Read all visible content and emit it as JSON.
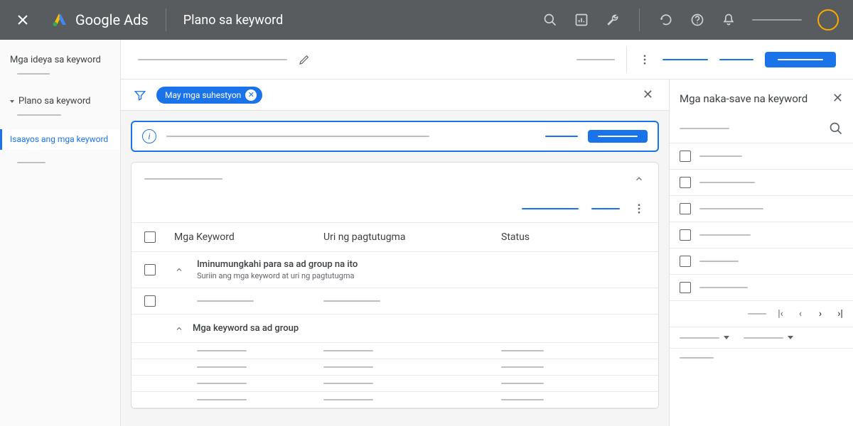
{
  "header": {
    "product": "Google Ads",
    "title": "Plano sa keyword"
  },
  "sidebar": {
    "ideas": "Mga ideya sa keyword",
    "plan": "Plano sa keyword",
    "organize": "Isaayos ang mga keyword"
  },
  "filter": {
    "chip": "May mga suhestyon"
  },
  "table": {
    "col_keywords": "Mga Keyword",
    "col_match": "Uri ng pagtutugma",
    "col_status": "Status",
    "suggested_title": "Iminumungkahi para sa ad group na ito",
    "suggested_sub": "Suriin ang mga keyword at uri ng pagtutugma",
    "section_adgroup": "Mga keyword sa ad group"
  },
  "right": {
    "title": "Mga naka-save na keyword"
  }
}
